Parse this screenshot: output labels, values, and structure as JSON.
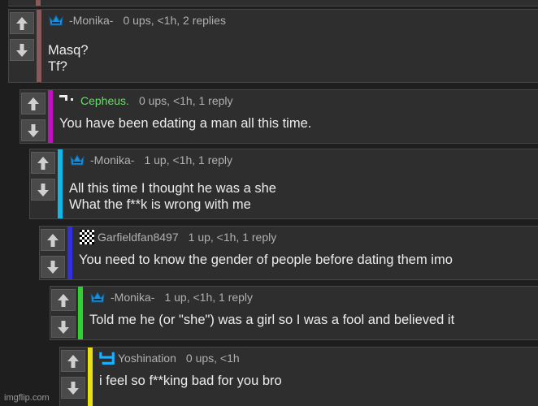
{
  "colors": {
    "background": "#1e1e1e",
    "panel": "#2e2e2e",
    "text": "#ececec",
    "meta_text": "#b0b0b0",
    "bar_maroon": "#8a5a5a",
    "bar_magenta": "#c010c0",
    "bar_cyan": "#10b8e8",
    "bar_blue": "#3030e0",
    "bar_green": "#30d030",
    "bar_yellow": "#e8e010",
    "username_green": "#6ed86e"
  },
  "icons": {
    "upvote": "arrow-up-icon",
    "downvote": "arrow-down-icon",
    "crown_avatar": "crown-icon",
    "pixel_avatar": "pixel-avatar-icon",
    "checker_avatar": "checkerboard-icon",
    "y_avatar": "y-glyph-icon"
  },
  "comments": [
    {
      "username": "-Monika-",
      "stats": "0 ups, <1h, 2 replies",
      "lines": [
        "Masq?",
        "Tf?"
      ]
    },
    {
      "username": "Cepheus.",
      "stats": "0 ups, <1h, 1 reply",
      "lines": [
        "You have been edating a man all this time."
      ]
    },
    {
      "username": "-Monika-",
      "stats": "1 up, <1h, 1 reply",
      "lines": [
        "All this time I thought he was a she",
        "What the f**k is wrong with me"
      ]
    },
    {
      "username": "Garfieldfan8497",
      "stats": "1 up, <1h, 1 reply",
      "lines": [
        "You need to know the gender of people before dating them imo"
      ]
    },
    {
      "username": "-Monika-",
      "stats": "1 up, <1h, 1 reply",
      "lines": [
        "Told me he (or \"she\") was a girl so I was a fool and believed it"
      ]
    },
    {
      "username": "Yoshination",
      "stats": "0 ups, <1h",
      "lines": [
        "i feel so f**king bad for you bro"
      ]
    }
  ],
  "watermark": "imgflip.com"
}
